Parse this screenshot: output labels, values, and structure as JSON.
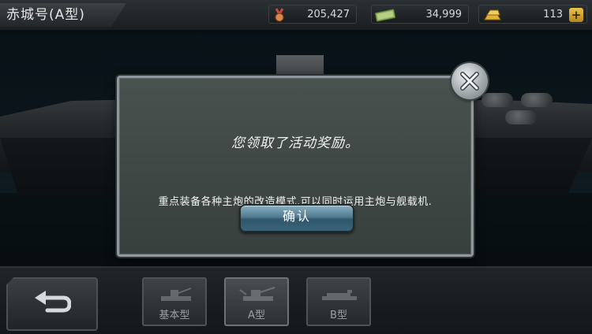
{
  "header": {
    "ship_name": "赤城号(A型)",
    "medals": "205,427",
    "cash": "34,999",
    "gold": "113",
    "gold_plus": "+"
  },
  "dialog": {
    "title": "您领取了活动奖励。",
    "description": "重点装备各种主炮的改造模式,可以同时运用主炮与舰载机.",
    "confirm_label": "确认"
  },
  "bottom": {
    "types": [
      {
        "label": "基本型"
      },
      {
        "label": "A型"
      },
      {
        "label": "B型"
      }
    ]
  },
  "colors": {
    "dialog_border": "#8e979b",
    "confirm_button": "#4f7b90",
    "gold_icon": "#e2b23a"
  }
}
